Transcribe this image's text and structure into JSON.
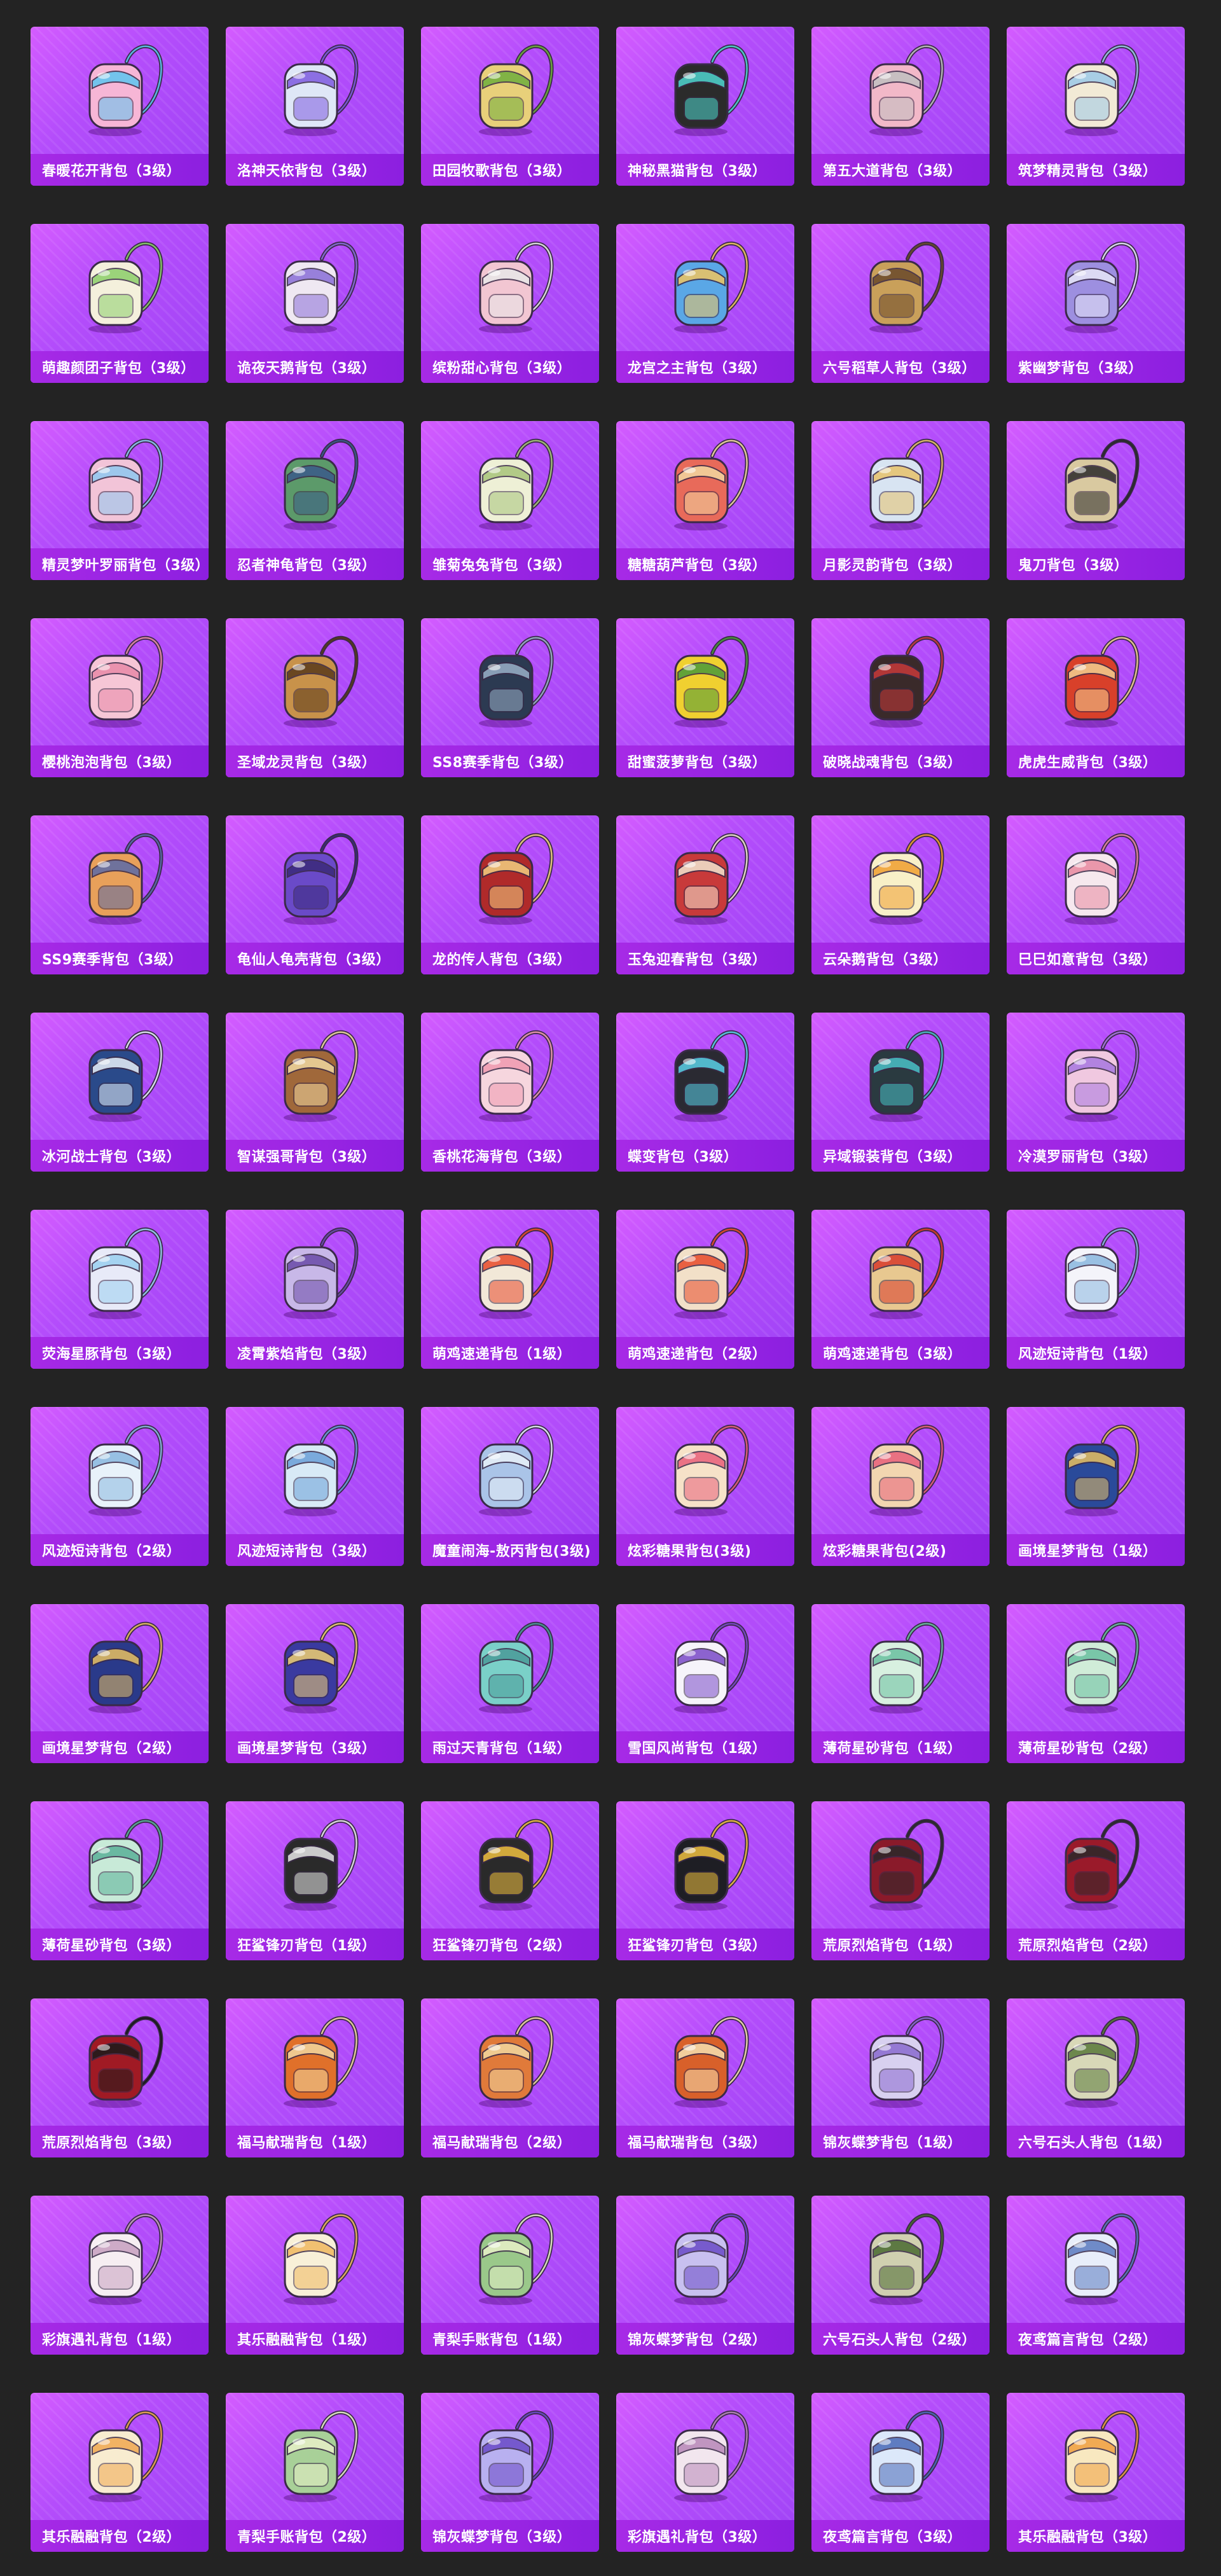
{
  "items": [
    {
      "name": "春暖花开背包（3级）",
      "icon": "flower-wing-backpack-icon",
      "color": "#f7b6d6",
      "accent": "#5cc6f0"
    },
    {
      "name": "洛神天依背包（3级）",
      "icon": "crystal-backpack-icon",
      "color": "#dfe7f7",
      "accent": "#7e5ae0"
    },
    {
      "name": "田园牧歌背包（3级）",
      "icon": "basket-backpack-icon",
      "color": "#e8d07a",
      "accent": "#6fae3c"
    },
    {
      "name": "神秘黑猫背包（3级）",
      "icon": "black-cat-backpack-icon",
      "color": "#2b2b2b",
      "accent": "#4fd6d0"
    },
    {
      "name": "第五大道背包（3级）",
      "icon": "quilted-bag-icon",
      "color": "#f2b8c8",
      "accent": "#c0c0c0"
    },
    {
      "name": "筑梦精灵背包（3级）",
      "icon": "fairy-backpack-icon",
      "color": "#f2ead6",
      "accent": "#9cc9e8"
    },
    {
      "name": "萌趣颜团子背包（3级）",
      "icon": "dumpling-plush-icon",
      "color": "#f4f0dc",
      "accent": "#8ccf6a"
    },
    {
      "name": "诡夜天鹅背包（3级）",
      "icon": "ghost-plush-icon",
      "color": "#efe8f2",
      "accent": "#8a6ed8"
    },
    {
      "name": "缤粉甜心背包（3级）",
      "icon": "pink-backpack-icon",
      "color": "#f2c6d2",
      "accent": "#e8e8e8"
    },
    {
      "name": "龙宫之主背包（3级）",
      "icon": "trident-emblem-icon",
      "color": "#5aa7e6",
      "accent": "#f0c560"
    },
    {
      "name": "六号稻草人背包（3级）",
      "icon": "scarecrow-backpack-icon",
      "color": "#c9a05a",
      "accent": "#6b4a2a"
    },
    {
      "name": "紫幽梦背包（3级）",
      "icon": "purple-orb-backpack-icon",
      "color": "#9d8fe0",
      "accent": "#e8e8f8"
    },
    {
      "name": "精灵梦叶罗丽背包（3级）",
      "icon": "heart-wing-backpack-icon",
      "color": "#f2c4d8",
      "accent": "#8fc8f0"
    },
    {
      "name": "忍者神龟背包（3级）",
      "icon": "turtle-backpack-icon",
      "color": "#5c9a6a",
      "accent": "#3a5a8a"
    },
    {
      "name": "雏菊兔兔背包（3级）",
      "icon": "daisy-bunny-backpack-icon",
      "color": "#eef0d6",
      "accent": "#a7c47a"
    },
    {
      "name": "糖糖葫芦背包（3级）",
      "icon": "gourd-backpack-icon",
      "color": "#e86a5a",
      "accent": "#f2d8a0"
    },
    {
      "name": "月影灵韵背包（3级）",
      "icon": "moon-backpack-icon",
      "color": "#d8e4f2",
      "accent": "#e8c26a"
    },
    {
      "name": "鬼刀背包（3级）",
      "icon": "blade-emblem-icon",
      "color": "#d9c9a0",
      "accent": "#2a2a2a"
    },
    {
      "name": "樱桃泡泡背包（3级）",
      "icon": "bow-backpack-icon",
      "color": "#f6c6d6",
      "accent": "#e88aa8"
    },
    {
      "name": "圣域龙灵背包（3级）",
      "icon": "dragon-shield-icon",
      "color": "#c8924a",
      "accent": "#5a3a1a"
    },
    {
      "name": "SS8赛季背包（3级）",
      "icon": "tactical-backpack-icon",
      "color": "#2c3a52",
      "accent": "#9ab0c8"
    },
    {
      "name": "甜蜜菠萝背包（3级）",
      "icon": "pineapple-backpack-icon",
      "color": "#f0d030",
      "accent": "#4a9a3a"
    },
    {
      "name": "破晓战魂背包（3级）",
      "icon": "armor-backpack-icon",
      "color": "#3a2a2a",
      "accent": "#c83a3a"
    },
    {
      "name": "虎虎生威背包（3级）",
      "icon": "tiger-backpack-icon",
      "color": "#d8402a",
      "accent": "#f2d090"
    },
    {
      "name": "SS9赛季背包（3级）",
      "icon": "striped-backpack-icon",
      "color": "#e8a05a",
      "accent": "#5a6aa8"
    },
    {
      "name": "龟仙人龟壳背包（3级）",
      "icon": "turtle-shell-icon",
      "color": "#6a4ac8",
      "accent": "#3a2a7a"
    },
    {
      "name": "龙的传人背包（3级）",
      "icon": "red-gold-backpack-icon",
      "color": "#b02a2a",
      "accent": "#f2d080"
    },
    {
      "name": "玉兔迎春背包（3级）",
      "icon": "rabbit-spring-backpack-icon",
      "color": "#c83a3a",
      "accent": "#f2e6d0"
    },
    {
      "name": "云朵鹅背包（3级）",
      "icon": "cloud-goose-icon",
      "color": "#f8f0c8",
      "accent": "#f0a030"
    },
    {
      "name": "巳巳如意背包（3级）",
      "icon": "snake-plush-icon",
      "color": "#f6e8ee",
      "accent": "#e88aa0"
    },
    {
      "name": "冰河战士背包（3级）",
      "icon": "ice-warrior-backpack-icon",
      "color": "#2a4a8a",
      "accent": "#e8f0f8"
    },
    {
      "name": "智谋强哥背包（3级）",
      "icon": "bear-plush-icon",
      "color": "#a0683a",
      "accent": "#f0d8a0"
    },
    {
      "name": "香桃花海背包（3级）",
      "icon": "peach-blossom-icon",
      "color": "#f6d6de",
      "accent": "#f09ab0"
    },
    {
      "name": "蝶变背包（3级）",
      "icon": "butterfly-backpack-icon",
      "color": "#2a2a32",
      "accent": "#5ad0e8"
    },
    {
      "name": "异域锻装背包（3级）",
      "icon": "forge-backpack-icon",
      "color": "#2a3a40",
      "accent": "#4ac0c8"
    },
    {
      "name": "冷漠罗丽背包（3级）",
      "icon": "cold-heart-icon",
      "color": "#f0c8e0",
      "accent": "#a878e0"
    },
    {
      "name": "荧海星豚背包（3级）",
      "icon": "star-dolphin-icon",
      "color": "#e8eaf8",
      "accent": "#9ad0f0"
    },
    {
      "name": "凌霄紫焰背包（3级）",
      "icon": "purple-flame-icon",
      "color": "#c8b8e8",
      "accent": "#6a4aa8"
    },
    {
      "name": "萌鸡速递背包（1级）",
      "icon": "chick-backpack-icon",
      "color": "#f2e8d8",
      "accent": "#e84a2a"
    },
    {
      "name": "萌鸡速递背包（2级）",
      "icon": "chick-backpack-icon",
      "color": "#f2e0c8",
      "accent": "#e84a2a"
    },
    {
      "name": "萌鸡速递背包（3级）",
      "icon": "chick-backpack-icon",
      "color": "#e8c890",
      "accent": "#d83a2a"
    },
    {
      "name": "风迹短诗背包（1级）",
      "icon": "poem-pouch-icon",
      "color": "#f4f4fa",
      "accent": "#8ab8e0"
    },
    {
      "name": "风迹短诗背包（2级）",
      "icon": "poem-pouch-icon",
      "color": "#e8f2fa",
      "accent": "#8ab8e0"
    },
    {
      "name": "风迹短诗背包（3级）",
      "icon": "poem-pouch-icon",
      "color": "#d8eaf6",
      "accent": "#6aa0d8"
    },
    {
      "name": "魔童闹海-敖丙背包(3级)",
      "icon": "swirl-orb-icon",
      "color": "#aac4e8",
      "accent": "#e8f0f8"
    },
    {
      "name": "炫彩糖果背包(3级)",
      "icon": "candy-backpack-icon",
      "color": "#f6e2c8",
      "accent": "#e8607a"
    },
    {
      "name": "炫彩糖果背包(2级)",
      "icon": "candy-backpack-icon",
      "color": "#f2d6b0",
      "accent": "#e8607a"
    },
    {
      "name": "画境星梦背包（1级）",
      "icon": "star-book-icon",
      "color": "#2a4a9a",
      "accent": "#e8c060"
    },
    {
      "name": "画境星梦背包（2级）",
      "icon": "star-book-icon",
      "color": "#2a3a8a",
      "accent": "#e8c060"
    },
    {
      "name": "画境星梦背包（3级）",
      "icon": "star-book-icon",
      "color": "#3a3aa0",
      "accent": "#f0d070"
    },
    {
      "name": "雨过天青背包（1级）",
      "icon": "raindrop-icon",
      "color": "#7ad0c8",
      "accent": "#4a9a98"
    },
    {
      "name": "雪国风尚背包（1级）",
      "icon": "snow-bunny-icon",
      "color": "#f6f4fa",
      "accent": "#7a4ac8"
    },
    {
      "name": "薄荷星砂背包（1级）",
      "icon": "mint-pouch-icon",
      "color": "#d8f0e0",
      "accent": "#6ac0a0"
    },
    {
      "name": "薄荷星砂背包（2级）",
      "icon": "mint-pouch-icon",
      "color": "#d0ecd8",
      "accent": "#6ac0a0"
    },
    {
      "name": "薄荷星砂背包（3级）",
      "icon": "mint-pouch-icon",
      "color": "#c8ead8",
      "accent": "#5ab098"
    },
    {
      "name": "狂鲨锋刃背包（1级）",
      "icon": "shark-backpack-icon",
      "color": "#2a2a2a",
      "accent": "#e8e8e8"
    },
    {
      "name": "狂鲨锋刃背包（2级）",
      "icon": "shark-backpack-icon",
      "color": "#2a2a2a",
      "accent": "#f0c040"
    },
    {
      "name": "狂鲨锋刃背包（3级）",
      "icon": "shark-backpack-icon",
      "color": "#1e1e24",
      "accent": "#f0c040"
    },
    {
      "name": "荒原烈焰背包（1级）",
      "icon": "flame-backpack-icon",
      "color": "#8a1a2a",
      "accent": "#2a2a2a"
    },
    {
      "name": "荒原烈焰背包（2级）",
      "icon": "flame-backpack-icon",
      "color": "#9a1a2a",
      "accent": "#2a2a2a"
    },
    {
      "name": "荒原烈焰背包（3级）",
      "icon": "flame-backpack-icon",
      "color": "#a01a24",
      "accent": "#1a1a1a"
    },
    {
      "name": "福马献瑞背包（1级）",
      "icon": "horse-plush-icon",
      "color": "#e0702a",
      "accent": "#f2d8a0"
    },
    {
      "name": "福马献瑞背包（2级）",
      "icon": "horse-plush-icon",
      "color": "#e07a3a",
      "accent": "#f2d8a0"
    },
    {
      "name": "福马献瑞背包（3级）",
      "icon": "horse-plush-icon",
      "color": "#d8602a",
      "accent": "#f6e0b0"
    },
    {
      "name": "锦灰蝶梦背包（1级）",
      "icon": "diamond-charm-icon",
      "color": "#d8d0f0",
      "accent": "#8a6ad0"
    },
    {
      "name": "六号石头人背包（1级）",
      "icon": "stone-golem-icon",
      "color": "#d8d8b8",
      "accent": "#5a7a3a"
    },
    {
      "name": "彩旗遇礼背包（1级）",
      "icon": "gift-bunny-icon",
      "color": "#f6eef2",
      "accent": "#c8a0c0"
    },
    {
      "name": "其乐融融背包（1级）",
      "icon": "cupcake-backpack-icon",
      "color": "#f8f0d8",
      "accent": "#f0b860"
    },
    {
      "name": "青梨手账背包（1级）",
      "icon": "pear-snail-icon",
      "color": "#9ac88a",
      "accent": "#e8f0c8"
    },
    {
      "name": "锦灰蝶梦背包（2级）",
      "icon": "diamond-charm-icon",
      "color": "#c8c0f0",
      "accent": "#6a4ac8"
    },
    {
      "name": "六号石头人背包（2级）",
      "icon": "stone-golem-icon",
      "color": "#d0d0b0",
      "accent": "#4a6a30"
    },
    {
      "name": "夜鸢篇言背包（2级）",
      "icon": "night-kite-icon",
      "color": "#e8eefa",
      "accent": "#5a7ac0"
    },
    {
      "name": "其乐融融背包（2级）",
      "icon": "cupcake-backpack-icon",
      "color": "#f8ecd0",
      "accent": "#f0a850"
    },
    {
      "name": "青梨手账背包（2级）",
      "icon": "pear-snail-icon",
      "color": "#a8d098",
      "accent": "#e8f0c8"
    },
    {
      "name": "锦灰蝶梦背包（3级）",
      "icon": "diamond-charm-icon",
      "color": "#b8b0f0",
      "accent": "#6a4ac8"
    },
    {
      "name": "彩旗遇礼背包（3级）",
      "icon": "gift-bunny-icon",
      "color": "#f2e6ee",
      "accent": "#b888b8"
    },
    {
      "name": "夜鸢篇言背包（3级）",
      "icon": "night-kite-icon",
      "color": "#dce8fa",
      "accent": "#4a6ab8"
    },
    {
      "name": "其乐融融背包（3级）",
      "icon": "cupcake-backpack-icon",
      "color": "#f8e8c0",
      "accent": "#f0a040"
    }
  ]
}
